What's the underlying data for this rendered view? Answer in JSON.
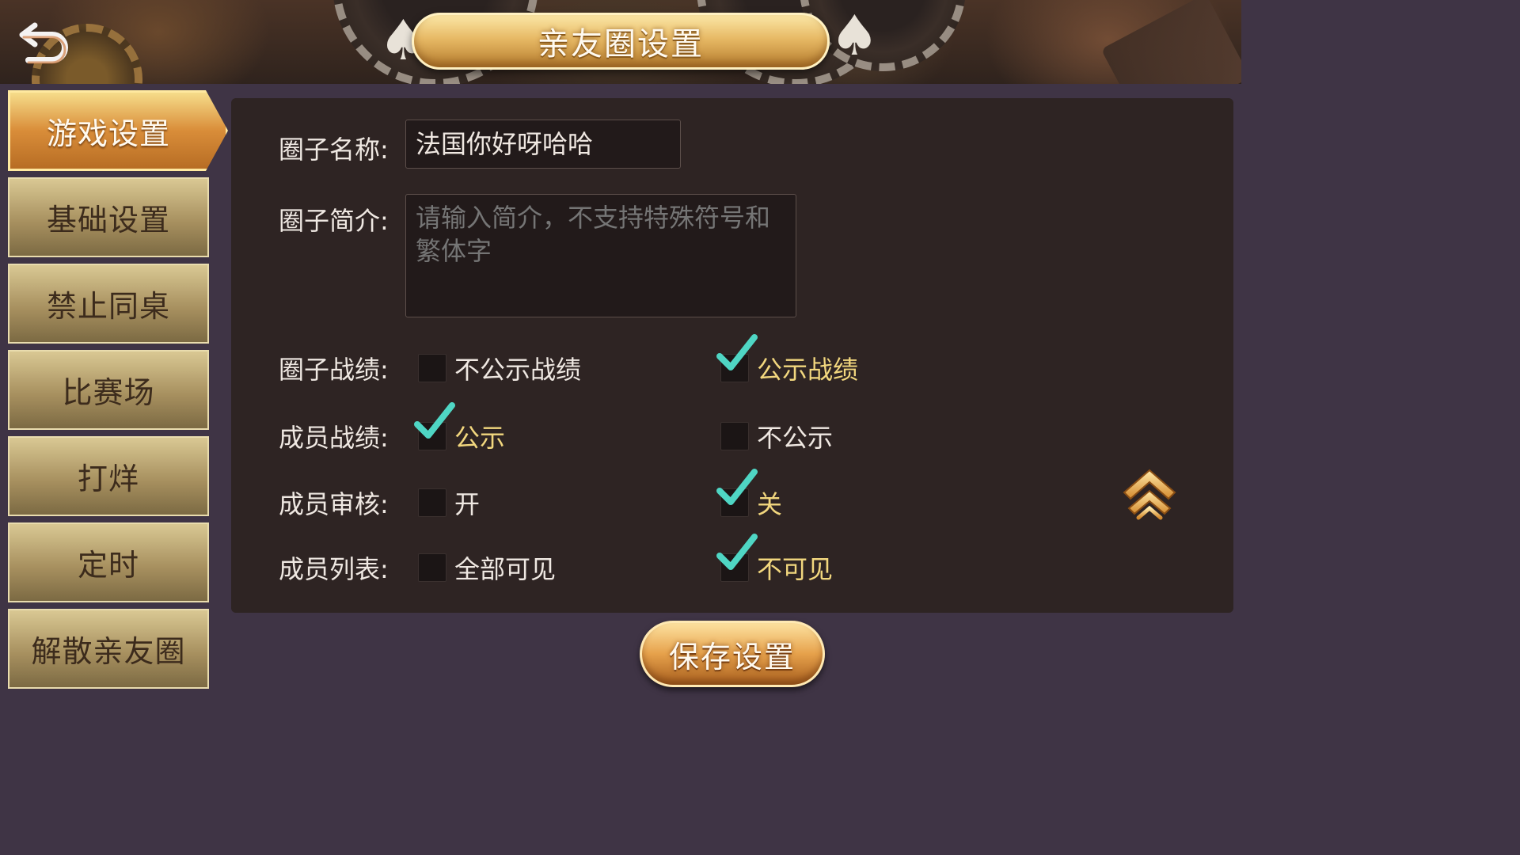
{
  "header": {
    "back_icon": "undo-arrow-icon",
    "title": "亲友圈设置"
  },
  "sidebar": {
    "items": [
      {
        "label": "游戏设置",
        "active": true
      },
      {
        "label": "基础设置",
        "active": false
      },
      {
        "label": "禁止同桌",
        "active": false
      },
      {
        "label": "比赛场",
        "active": false
      },
      {
        "label": "打烊",
        "active": false
      },
      {
        "label": "定时",
        "active": false
      },
      {
        "label": "解散亲友圈",
        "active": false
      }
    ]
  },
  "form": {
    "name_label": "圈子名称:",
    "name_value": "法国你好呀哈哈",
    "intro_label": "圈子简介:",
    "intro_placeholder": "请输入简介，不支持特殊符号和繁体字",
    "rows": [
      {
        "label": "圈子战绩:",
        "options": [
          {
            "text": "不公示战绩",
            "checked": false
          },
          {
            "text": "公示战绩",
            "checked": true
          }
        ]
      },
      {
        "label": "成员战绩:",
        "options": [
          {
            "text": "公示",
            "checked": true
          },
          {
            "text": "不公示",
            "checked": false
          }
        ]
      },
      {
        "label": "成员审核:",
        "options": [
          {
            "text": "开",
            "checked": false
          },
          {
            "text": "关",
            "checked": true
          }
        ]
      },
      {
        "label": "成员列表:",
        "options": [
          {
            "text": "全部可见",
            "checked": false
          },
          {
            "text": "不可见",
            "checked": true
          }
        ]
      }
    ],
    "scroll_up_icon": "double-chevron-up-icon"
  },
  "footer": {
    "save_label": "保存设置"
  },
  "colors": {
    "accent_gold": "#f2d77e",
    "check_teal": "#4fd6c4",
    "panel_bg": "#2e2423",
    "page_bg": "#3f3445"
  }
}
